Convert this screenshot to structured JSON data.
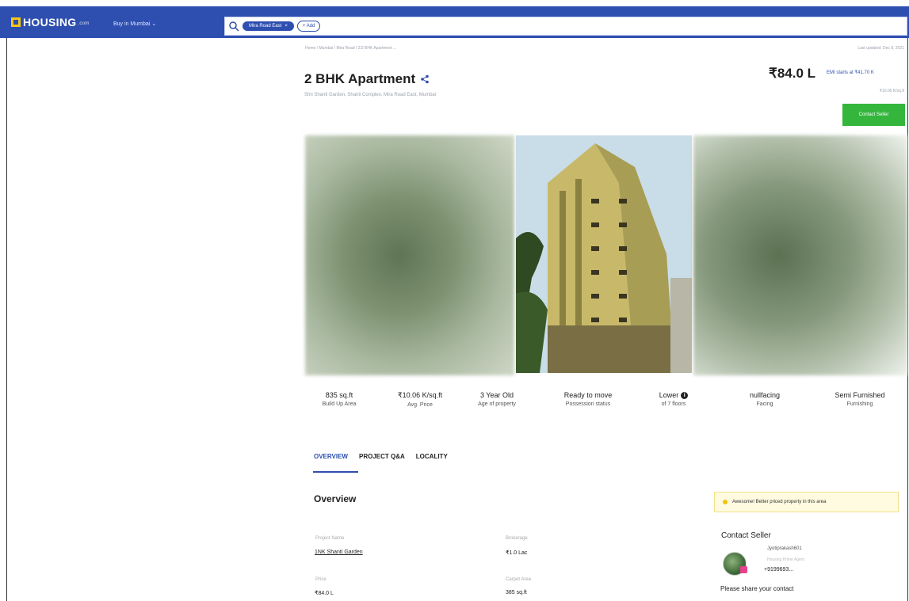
{
  "header": {
    "logo_text": "HOUSING",
    "logo_suffix": ".com",
    "city_select": "Buy in Mumbai",
    "search_chip": "Mira Road East",
    "add_chip": "+ Add"
  },
  "listing": {
    "breadcrumb": "Home / Mumbai / Mira Road / 2/2 BHK Apartment ...",
    "last_updated": "Last updated: Dec 8, 2021",
    "title": "2 BHK Apartment",
    "subtitle": "Shri Shanti Garden, Shanti Complex, Mira Road East, Mumbai",
    "price": "₹84.0 L",
    "emi": "EMI starts at ₹41.70 K",
    "price_sub": "₹10.06 K/sq.ft",
    "contact_button": "Contact Seller"
  },
  "stats": [
    {
      "value": "835 sq.ft",
      "label": "Build Up Area"
    },
    {
      "value": "₹10.06 K/sq.ft",
      "label": "Avg. Price"
    },
    {
      "value": "3 Year Old",
      "label": "Age of property"
    },
    {
      "value": "Ready to move",
      "label": "Possession status"
    },
    {
      "value": "Lower",
      "label": "of 7 floors"
    },
    {
      "value": "nullfacing",
      "label": "Facing"
    },
    {
      "value": "Semi Furnished",
      "label": "Furnishing"
    }
  ],
  "tabs": [
    "OVERVIEW",
    "PROJECT Q&A",
    "LOCALITY"
  ],
  "overview": {
    "heading": "Overview",
    "fields": [
      {
        "label": "Project Name",
        "value": "1NK Shanti Garden"
      },
      {
        "label": "Brokerage",
        "value": "₹1.0 Lac"
      },
      {
        "label": "Price",
        "value": "₹84.0 L"
      },
      {
        "label": "Carpet Area",
        "value": "385 sq.ft"
      }
    ]
  },
  "side": {
    "promo": "Awesome! Better priced property in this area",
    "contact_heading": "Contact Seller",
    "seller_name": "Jyotiprakash601",
    "seller_role": "Housing Prime Agent",
    "seller_phone": "+9199693...",
    "share_contact": "Please share your contact"
  }
}
